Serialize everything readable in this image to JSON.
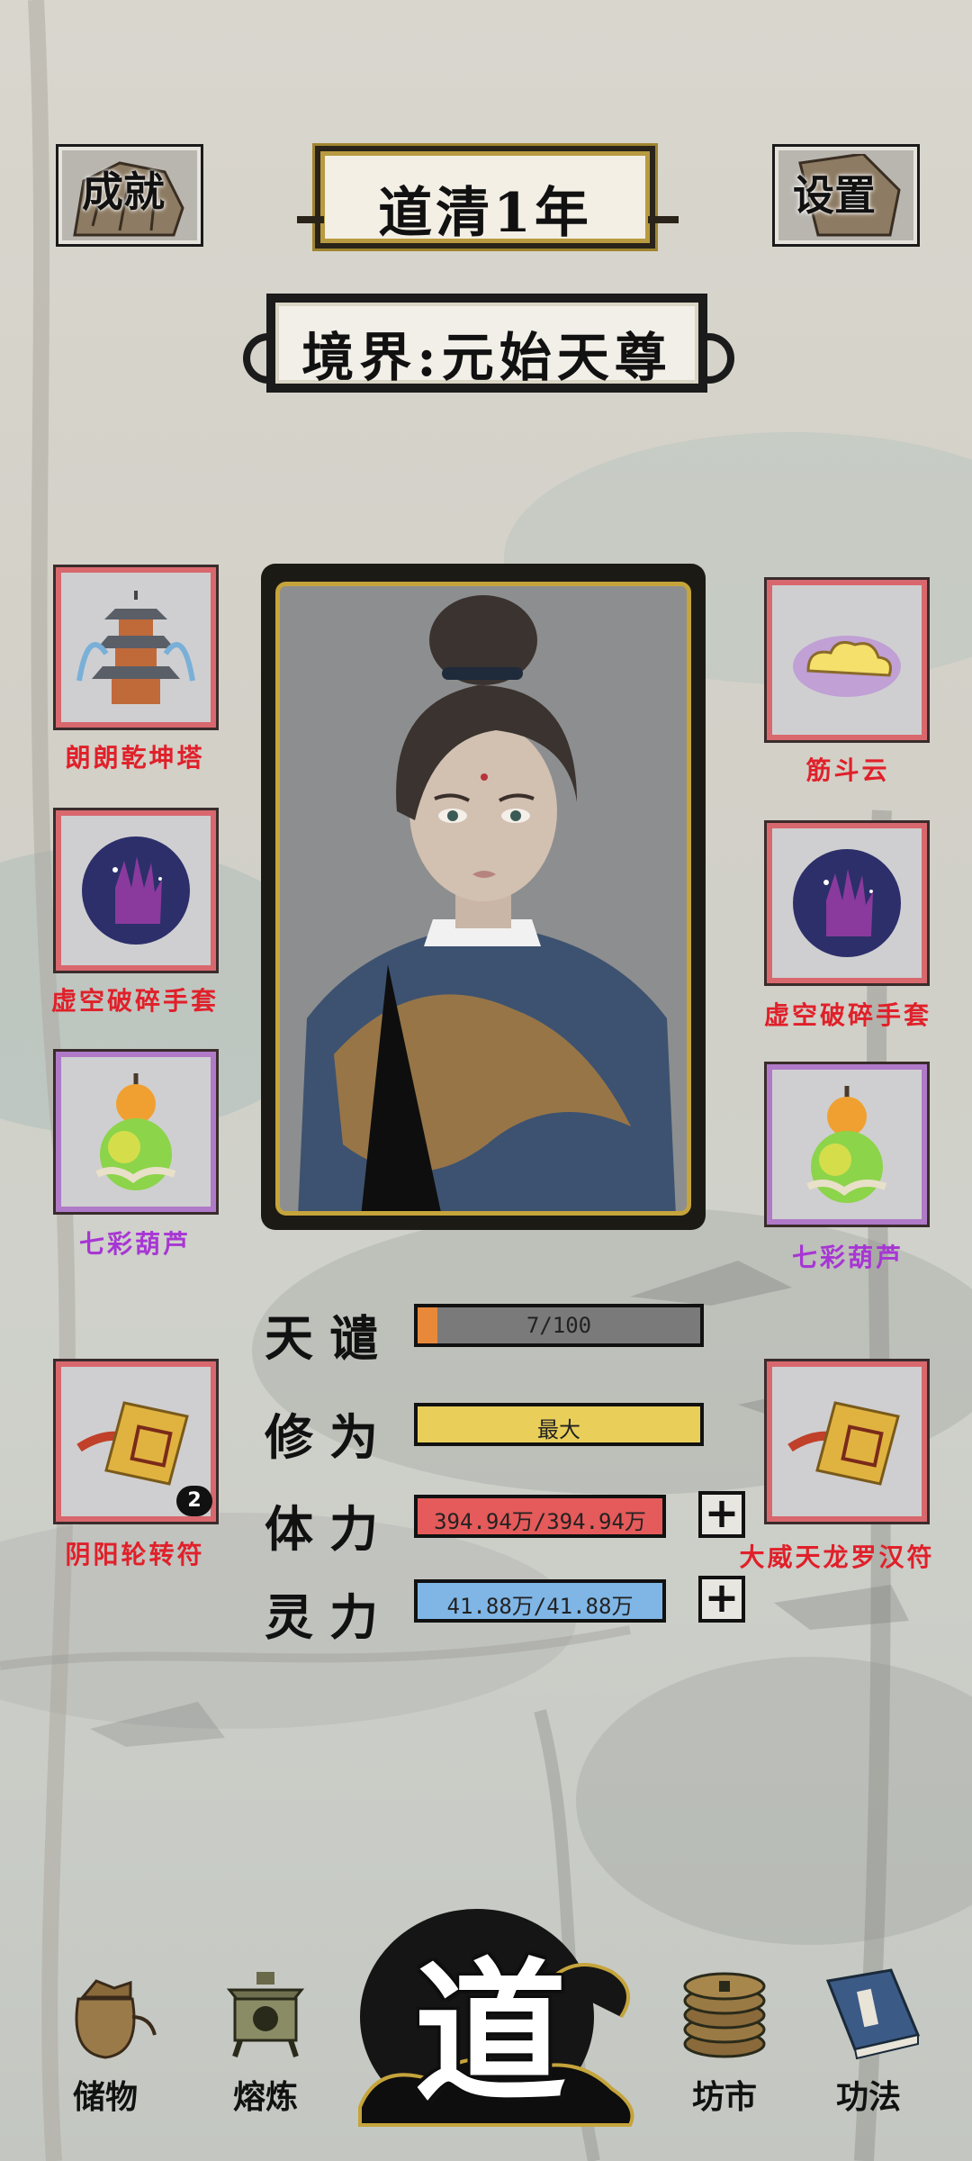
{
  "top": {
    "achievements_label": "成就",
    "settings_label": "设置",
    "era_title": "道清1年",
    "realm": "境界:元始天尊"
  },
  "equipment": {
    "left": [
      {
        "name": "朗朗乾坤塔",
        "icon": "pagoda-icon",
        "rarity_color": "#e0202a"
      },
      {
        "name": "虚空破碎手套",
        "icon": "gauntlet-icon",
        "rarity_color": "#e0202a"
      },
      {
        "name": "七彩葫芦",
        "icon": "gourd-icon",
        "rarity_color": "#a736d4"
      },
      {
        "name": "阴阳轮转符",
        "icon": "talisman-icon",
        "rarity_color": "#e0202a",
        "count": "2"
      }
    ],
    "right": [
      {
        "name": "筋斗云",
        "icon": "cloud-icon",
        "rarity_color": "#e0202a"
      },
      {
        "name": "虚空破碎手套",
        "icon": "gauntlet-icon",
        "rarity_color": "#e0202a"
      },
      {
        "name": "七彩葫芦",
        "icon": "gourd-icon",
        "rarity_color": "#a736d4"
      },
      {
        "name": "大威天龙罗汉符",
        "icon": "talisman-icon",
        "rarity_color": "#e0202a"
      }
    ]
  },
  "stats": {
    "tianqian": {
      "label": "天谴",
      "text": "7/100",
      "fill": 0.07,
      "color": "#e8893a"
    },
    "xiuwei": {
      "label": "修为",
      "text": "最大",
      "fill": 1.0,
      "color": "#e9cf5a"
    },
    "tili": {
      "label": "体力",
      "text": "394.94万/394.94万",
      "fill": 1.0,
      "color": "#e55a5a"
    },
    "lingli": {
      "label": "灵力",
      "text": "41.88万/41.88万",
      "fill": 1.0,
      "color": "#7fb6e6"
    }
  },
  "nav": {
    "storage": "储物",
    "refine": "熔炼",
    "dao": "道",
    "market": "坊市",
    "skills": "功法"
  }
}
